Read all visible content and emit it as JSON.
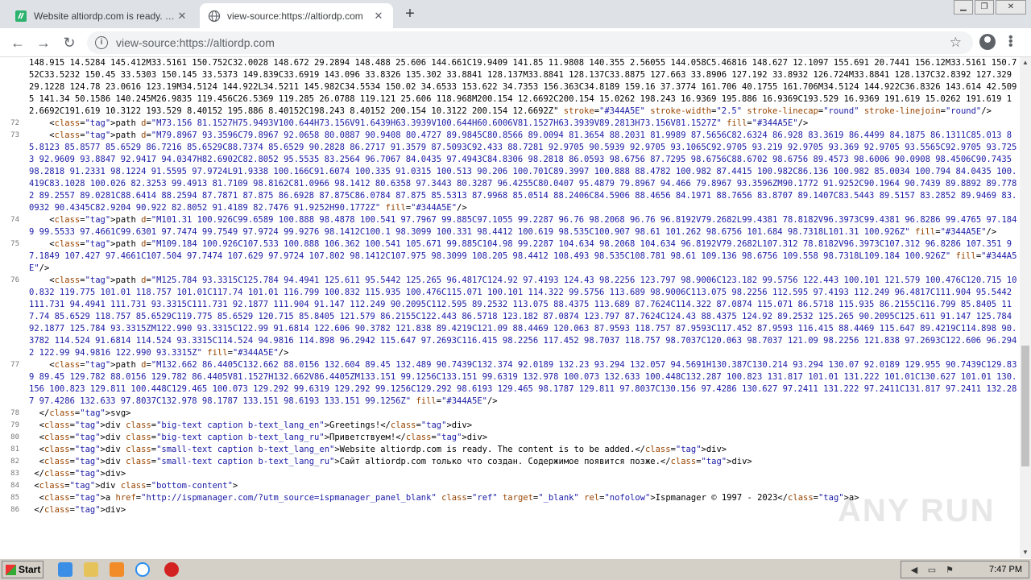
{
  "tabs": [
    {
      "title": "Website altiordp.com is ready. The c",
      "favicon": "green-document-icon",
      "active": false
    },
    {
      "title": "view-source:https://altiordp.com",
      "favicon": "globe-icon",
      "active": true
    }
  ],
  "omnibox": {
    "url": "view-source:https://altiordp.com"
  },
  "source_lines": [
    {
      "n": "",
      "text": "148.915 14.5284 145.412M33.5161 150.752C32.0028 148.672 29.2894 148.488 25.606 144.661C19.9409 141.85 11.9808 140.355 2.56055 144.058C5.46816 148.627 12.1097 155.691 20.7441 156.12M33.5161 150.752C33.5232 150.45 33.5303 150.145 33.5373 149.839C33.6919 143.096 33.8326 135.302 33.8841 128.137M33.8841 128.137C33.8875 127.663 33.8906 127.192 33.8932 126.724M33.8841 128.137C32.8392 127.329 29.1228 124.78 23.0616 123.19M34.5124 144.922L34.5211 145.982C34.5534 150.02 34.6533 153.622 34.7353 156.363C34.8189 159.16 37.3774 161.706 40.1755 161.706M34.5124 144.922C36.8326 143.614 42.5095 141.34 50.1586 140.245M26.9835 119.456C26.5369 119.285 26.0788 119.121 25.606 118.968M200.154 12.6692C200.154 15.0262 198.243 16.9369 195.886 16.9369C193.529 16.9369 191.619 15.0262 191.619 12.6692C191.619 10.3122 193.529 8.40152 195.886 8.40152C198.243 8.40152 200.154 10.3122 200.154 12.6692Z\" stroke=\"#344A5E\" stroke-width=\"2.5\" stroke-linecap=\"round\" stroke-linejoin=\"round\"/>"
    },
    {
      "n": "72",
      "text": "    <path d=\"M73.156 81.1527H75.9493V100.644H73.156V91.6439H63.3939V100.644H60.6006V81.1527H63.3939V89.2813H73.156V81.1527Z\" fill=\"#344A5E\"/>"
    },
    {
      "n": "73",
      "text": "    <path d=\"M79.8967 93.3596C79.8967 92.0658 80.0887 90.9408 80.4727 89.9845C80.8566 89.0094 81.3654 88.2031 81.9989 87.5656C82.6324 86.928 83.3619 86.4499 84.1875 86.1311C85.013 85.8123 85.8577 85.6529 86.7216 85.6529C88.7374 85.6529 90.2828 86.2717 91.3579 87.5093C92.433 88.7281 92.9705 90.5939 92.9705 93.1065C92.9705 93.219 92.9705 93.369 92.9705 93.5565C92.9705 93.7253 92.9609 93.8847 92.9417 94.0347H82.6902C82.8052 95.5535 83.2564 96.7067 84.0435 97.4943C84.8306 98.2818 86.0593 98.6756 87.7295 98.6756C88.6702 98.6756 89.4573 98.6006 90.0908 98.4506C90.7435 98.2818 91.2331 98.1224 91.5595 97.9724L91.9338 100.166C91.6074 100.335 91.0315 100.513 90.206 100.701C89.3997 100.888 88.4782 100.982 87.4415 100.982C86.136 100.982 85.0034 100.794 84.0435 100.419C83.1028 100.026 82.3253 99.4913 81.7109 98.8162C81.0966 98.1412 80.6358 97.3443 80.3287 96.4255C80.0407 95.4879 79.8967 94.466 79.8967 93.3596ZM90.1772 91.9252C90.1964 90.7439 89.8892 89.7782 89.2557 89.0281C88.6414 88.2594 87.7871 87.875 86.6928 87.875C86.0784 87.875 85.5313 87.9968 85.0514 88.2406C84.5906 88.4656 84.1971 88.7656 83.8707 89.1407C83.5443 89.5157 83.2852 89.9469 83.0932 90.4345C82.9204 90.922 82.8052 91.4189 82.7476 91.9252H90.1772Z\" fill=\"#344A5E\"/>"
    },
    {
      "n": "74",
      "text": "    <path d=\"M101.31 100.926C99.6589 100.888 98.4878 100.541 97.7967 99.885C97.1055 99.2287 96.76 98.2068 96.76 96.8192V79.2682L99.4381 78.8182V96.3973C99.4381 96.8286 99.4765 97.1849 99.5533 97.4661C99.6301 97.7474 99.7549 97.9724 99.9276 98.1412C100.1 98.3099 100.331 98.4412 100.619 98.535C100.907 98.61 101.262 98.6756 101.684 98.7318L101.31 100.926Z\" fill=\"#344A5E\"/>"
    },
    {
      "n": "75",
      "text": "    <path d=\"M109.184 100.926C107.533 100.888 106.362 100.541 105.671 99.885C104.98 99.2287 104.634 98.2068 104.634 96.8192V79.2682L107.312 78.8182V96.3973C107.312 96.8286 107.351 97.1849 107.427 97.4661C107.504 97.7474 107.629 97.9724 107.802 98.1412C107.975 98.3099 108.205 98.4412 108.493 98.535C108.781 98.61 109.136 98.6756 109.558 98.7318L109.184 100.926Z\" fill=\"#344A5E\"/>"
    },
    {
      "n": "76",
      "text": "    <path d=\"M125.784 93.3315C125.784 94.4941 125.611 95.5442 125.265 96.4817C124.92 97.4193 124.43 98.2256 123.797 98.9006C123.182 99.5756 122.443 100.101 121.579 100.476C120.715 100.832 119.775 101.01 118.757 101.01C117.74 101.01 116.799 100.832 115.935 100.476C115.071 100.101 114.322 99.5756 113.689 98.9006C113.075 98.2256 112.595 97.4193 112.249 96.4817C111.904 95.5442 111.731 94.4941 111.731 93.3315C111.731 92.1877 111.904 91.147 112.249 90.2095C112.595 89.2532 113.075 88.4375 113.689 87.7624C114.322 87.0874 115.071 86.5718 115.935 86.2155C116.799 85.8405 117.74 85.6529 118.757 85.6529C119.775 85.6529 120.715 85.8405 121.579 86.2155C122.443 86.5718 123.182 87.0874 123.797 87.7624C124.43 88.4375 124.92 89.2532 125.265 90.2095C125.611 91.147 125.784 92.1877 125.784 93.3315ZM122.990 93.3315C122.99 91.6814 122.606 90.3782 121.838 89.4219C121.09 88.4469 120.063 87.9593 118.757 87.9593C117.452 87.9593 116.415 88.4469 115.647 89.4219C114.898 90.3782 114.524 91.6814 114.524 93.3315C114.524 94.9816 114.898 96.2942 115.647 97.2693C116.415 98.2256 117.452 98.7037 118.757 98.7037C120.063 98.7037 121.09 98.2256 121.838 97.2693C122.606 96.2942 122.99 94.9816 122.990 93.3315Z\" fill=\"#344A5E\"/>"
    },
    {
      "n": "77",
      "text": "    <path d=\"M132.662 86.4405C132.662 88.0156 132.604 89.45 132.489 90.7439C132.374 92.0189 132.23 93.294 132.057 94.5691H130.387C130.214 93.294 130.07 92.0189 129.955 90.7439C129.839 89.45 129.782 88.0156 129.782 86.4405V81.1527H132.662V86.4405ZM133.151 99.1256C133.151 99.6319 132.978 100.073 132.633 100.448C132.287 100.823 131.817 101.01 131.222 101.01C130.627 101.01 130.156 100.823 129.811 100.448C129.465 100.073 129.292 99.6319 129.292 99.1256C129.292 98.6193 129.465 98.1787 129.811 97.8037C130.156 97.4286 130.627 97.2411 131.222 97.2411C131.817 97.2411 132.287 97.4286 132.633 97.8037C132.978 98.1787 133.151 98.6193 133.151 99.1256Z\" fill=\"#344A5E\"/>"
    },
    {
      "n": "78",
      "text": "  </svg>"
    },
    {
      "n": "79",
      "text": "  <div class=\"big-text caption b-text_lang_en\">Greetings!</div>"
    },
    {
      "n": "80",
      "text": "  <div class=\"big-text caption b-text_lang_ru\">Приветствуем!</div>"
    },
    {
      "n": "81",
      "text": "  <div class=\"small-text caption b-text_lang_en\">Website altiordp.com is ready. The content is to be added.</div>"
    },
    {
      "n": "82",
      "text": "  <div class=\"small-text caption b-text_lang_ru\">Сайт altiordp.com только что создан. Содержимое появится позже.</div>"
    },
    {
      "n": "83",
      "text": " </div>"
    },
    {
      "n": "84",
      "text": " <div class=\"bottom-content\">"
    },
    {
      "n": "85",
      "text": "  <a href=\"http://ispmanager.com/?utm_source=ispmanager_panel_blank\" class=\"ref\" target=\"_blank\" rel=\"nofolow\">Ispmanager © 1997 - 2023</a>"
    },
    {
      "n": "86",
      "text": " </div>"
    }
  ],
  "watermark": "ANY RUN",
  "taskbar": {
    "start_label": "Start",
    "clock": "7:47 PM"
  }
}
